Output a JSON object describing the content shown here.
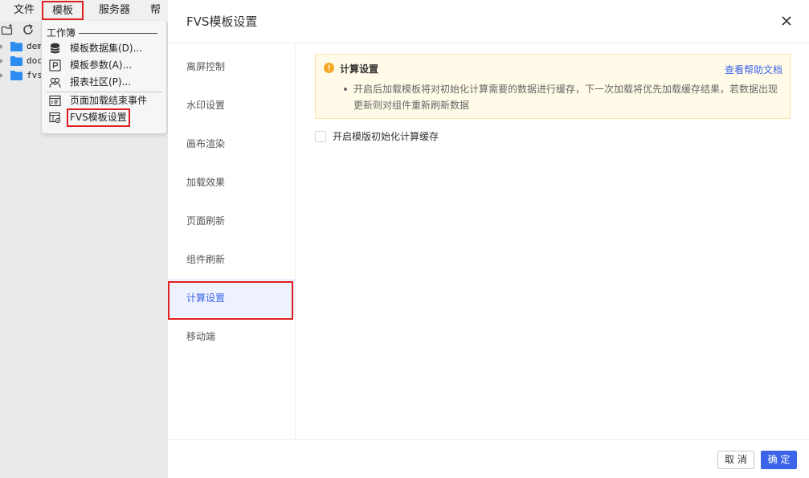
{
  "menubar": {
    "file": "文件",
    "template": "模板",
    "server": "服务器",
    "help": "帮助"
  },
  "tree": {
    "items": [
      {
        "name": "demo"
      },
      {
        "name": "doc"
      },
      {
        "name": "fvs"
      }
    ]
  },
  "dropdown": {
    "section_label": "工作簿",
    "items": [
      {
        "label": "模板数据集(D)...",
        "icon": "database-icon"
      },
      {
        "label": "模板参数(A)...",
        "icon": "parameter-icon"
      },
      {
        "label": "报表社区(P)...",
        "icon": "community-icon"
      },
      {
        "label": "页面加载结束事件",
        "icon": "page-event-icon"
      },
      {
        "label": "FVS模板设置",
        "icon": "fvs-settings-icon"
      }
    ]
  },
  "dialog": {
    "title": "FVS模板设置",
    "nav": [
      {
        "label": "离屏控制"
      },
      {
        "label": "水印设置"
      },
      {
        "label": "画布渲染"
      },
      {
        "label": "加载效果"
      },
      {
        "label": "页面刷新"
      },
      {
        "label": "组件刷新"
      },
      {
        "label": "计算设置"
      },
      {
        "label": "移动端"
      }
    ],
    "active_nav": "计算设置",
    "notice": {
      "title": "计算设置",
      "help_link": "查看帮助文档",
      "text": "开启后加载模板将对初始化计算需要的数据进行缓存，下一次加载将优先加载缓存结果，若数据出现更新则对组件重新刷新数据"
    },
    "checkbox": {
      "label": "开启模版初始化计算缓存",
      "checked": false
    },
    "footer": {
      "cancel": "取 消",
      "ok": "确 定"
    }
  },
  "colors": {
    "accent": "#3c64e8",
    "highlight_box": "#e02020",
    "warning": "#f5a623",
    "folder": "#2d8cf0"
  }
}
